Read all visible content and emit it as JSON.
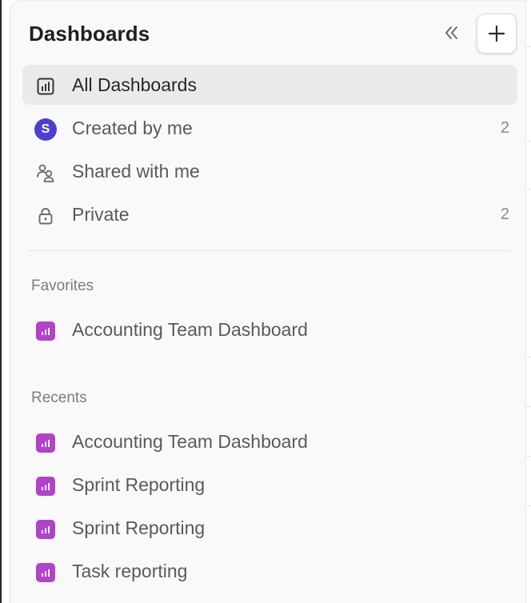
{
  "sidebar": {
    "title": "Dashboards",
    "collapse_icon": "double-chevron-left-icon",
    "add_icon": "plus-icon",
    "nav": [
      {
        "label": "All Dashboards",
        "icon": "bar-chart-icon",
        "count": "",
        "active": true
      },
      {
        "label": "Created by me",
        "icon": "avatar",
        "avatar_letter": "S",
        "count": "2"
      },
      {
        "label": "Shared with me",
        "icon": "shared-users-icon",
        "count": ""
      },
      {
        "label": "Private",
        "icon": "lock-icon",
        "count": "2"
      }
    ],
    "favorites": {
      "label": "Favorites",
      "items": [
        {
          "label": "Accounting Team Dashboard",
          "icon": "dashboard-tile-icon"
        }
      ]
    },
    "recents": {
      "label": "Recents",
      "items": [
        {
          "label": "Accounting Team Dashboard",
          "icon": "dashboard-tile-icon"
        },
        {
          "label": "Sprint Reporting",
          "icon": "dashboard-tile-icon"
        },
        {
          "label": "Sprint Reporting",
          "icon": "dashboard-tile-icon"
        },
        {
          "label": "Task reporting",
          "icon": "dashboard-tile-icon"
        }
      ]
    }
  },
  "colors": {
    "panel_bg": "#f9f9f9",
    "active_bg": "#eaeaea",
    "avatar": "#4b3fd1",
    "dashboard_tile": "#b242c9"
  }
}
